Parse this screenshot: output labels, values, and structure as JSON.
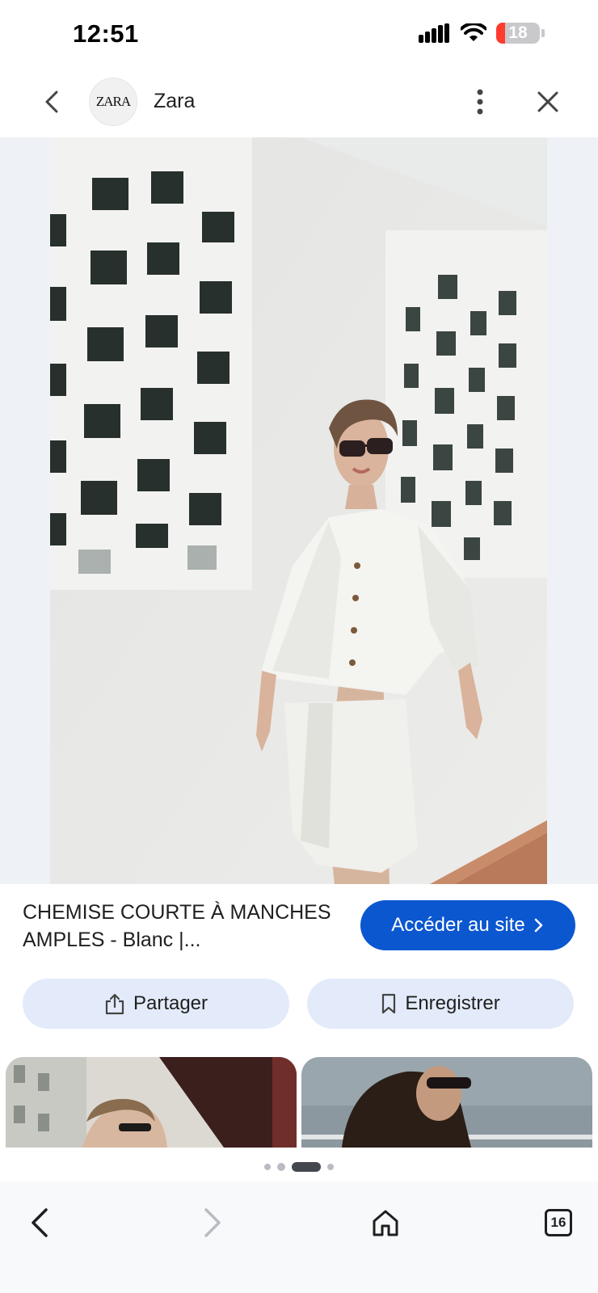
{
  "status": {
    "time": "12:51",
    "battery": "18"
  },
  "header": {
    "logo": "ZARA",
    "title": "Zara"
  },
  "product": {
    "title": "CHEMISE COURTE À MANCHES AMPLES - Blanc |...",
    "visit_label": "Accéder au site",
    "share_label": "Partager",
    "save_label": "Enregistrer"
  },
  "pager": {
    "count": 4,
    "active_index": 2
  },
  "bottom_nav": {
    "tab_count": "16"
  },
  "icons": [
    "back-icon",
    "logo",
    "more-vert-icon",
    "close-icon",
    "share-icon",
    "bookmark-icon",
    "chevron-right-icon",
    "home-icon",
    "tabs-icon",
    "forward-icon"
  ],
  "colors": {
    "accent": "#0b57d0",
    "chip_bg": "#e3ebfa",
    "battery_low": "#ff3b30"
  }
}
